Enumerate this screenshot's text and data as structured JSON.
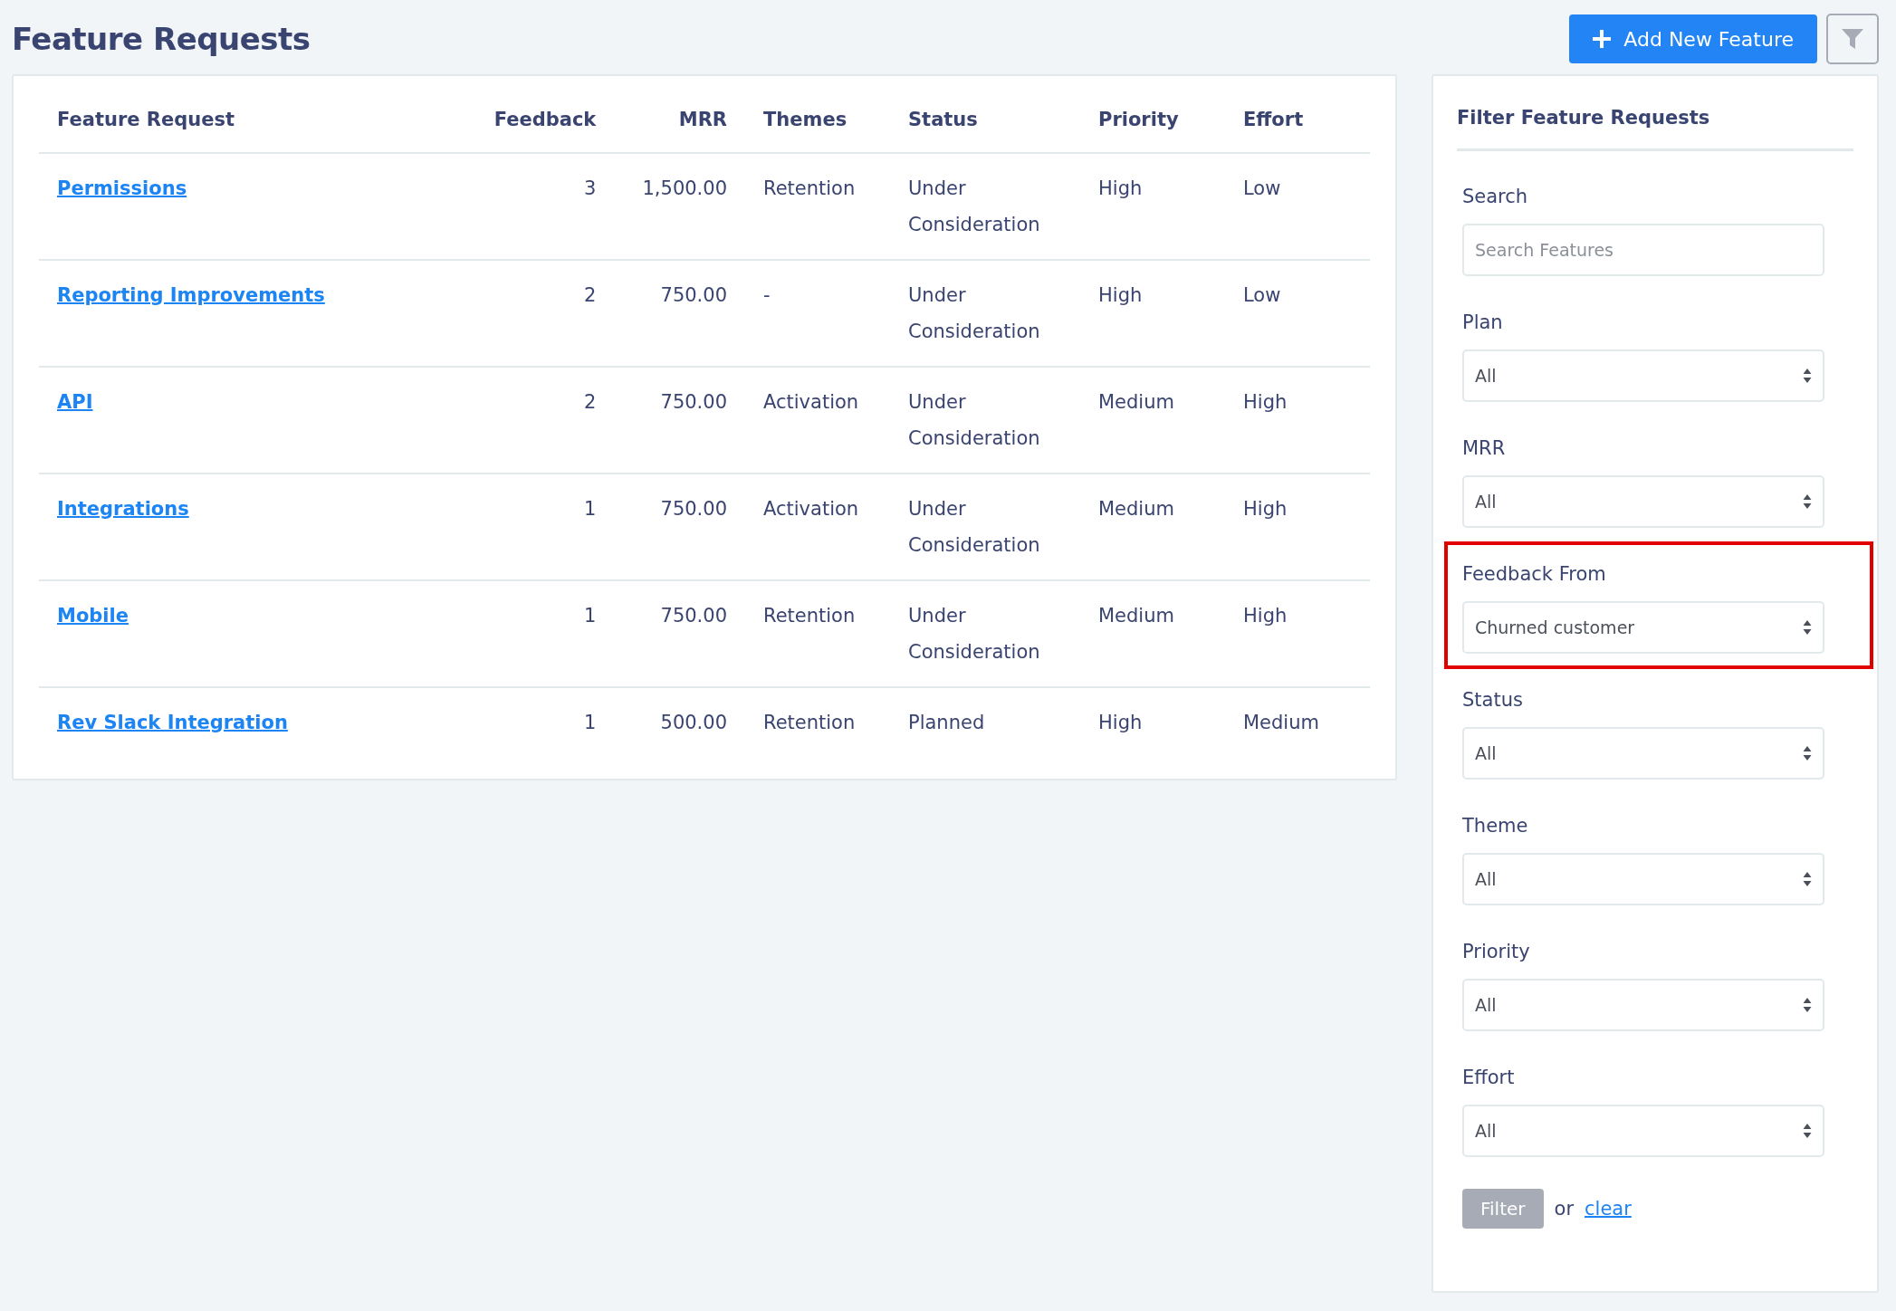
{
  "page": {
    "title": "Feature Requests",
    "add_button": "Add New Feature"
  },
  "table": {
    "columns": [
      "Feature Request",
      "Feedback",
      "MRR",
      "Themes",
      "Status",
      "Priority",
      "Effort"
    ],
    "rows": [
      {
        "name": "Permissions",
        "feedback": "3",
        "mrr": "1,500.00",
        "themes": "Retention",
        "status": "Under Consideration",
        "priority": "High",
        "effort": "Low"
      },
      {
        "name": "Reporting Improvements",
        "feedback": "2",
        "mrr": "750.00",
        "themes": "-",
        "status": "Under Consideration",
        "priority": "High",
        "effort": "Low"
      },
      {
        "name": "API",
        "feedback": "2",
        "mrr": "750.00",
        "themes": "Activation",
        "status": "Under Consideration",
        "priority": "Medium",
        "effort": "High"
      },
      {
        "name": "Integrations",
        "feedback": "1",
        "mrr": "750.00",
        "themes": "Activation",
        "status": "Under Consideration",
        "priority": "Medium",
        "effort": "High"
      },
      {
        "name": "Mobile",
        "feedback": "1",
        "mrr": "750.00",
        "themes": "Retention",
        "status": "Under Consideration",
        "priority": "Medium",
        "effort": "High"
      },
      {
        "name": "Rev Slack Integration",
        "feedback": "1",
        "mrr": "500.00",
        "themes": "Retention",
        "status": "Planned",
        "priority": "High",
        "effort": "Medium"
      }
    ]
  },
  "filters": {
    "title": "Filter Feature Requests",
    "fields": [
      {
        "kind": "text",
        "label": "Search",
        "placeholder": "Search Features",
        "highlighted": false
      },
      {
        "kind": "select",
        "label": "Plan",
        "value": "All",
        "highlighted": false
      },
      {
        "kind": "select",
        "label": "MRR",
        "value": "All",
        "highlighted": false
      },
      {
        "kind": "select",
        "label": "Feedback From",
        "value": "Churned customer",
        "highlighted": true
      },
      {
        "kind": "select",
        "label": "Status",
        "value": "All",
        "highlighted": false
      },
      {
        "kind": "select",
        "label": "Theme",
        "value": "All",
        "highlighted": false
      },
      {
        "kind": "select",
        "label": "Priority",
        "value": "All",
        "highlighted": false
      },
      {
        "kind": "select",
        "label": "Effort",
        "value": "All",
        "highlighted": false
      }
    ],
    "submit": "Filter",
    "separator": "or",
    "clear": "clear"
  }
}
